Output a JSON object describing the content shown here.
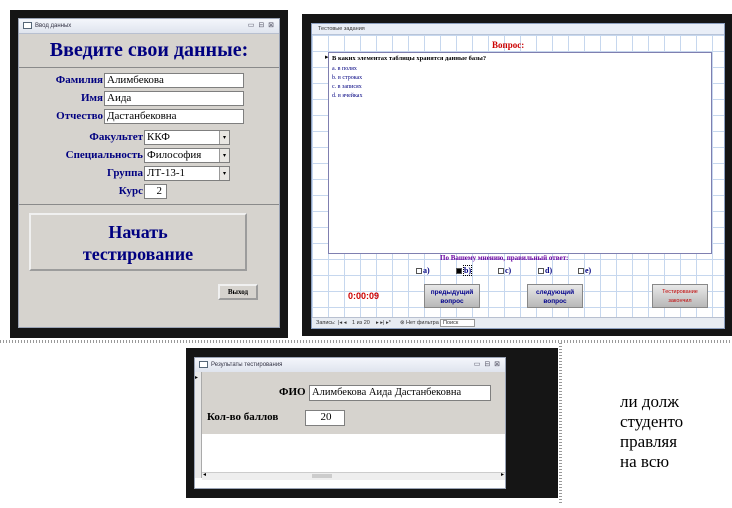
{
  "form1": {
    "window_title": "Ввод данных",
    "window_controls": "▭ ⊟ ⊠",
    "heading": "Введите свои данные:",
    "fields": [
      {
        "label": "Фамилия",
        "value": "Алимбекова"
      },
      {
        "label": "Имя",
        "value": "Аида"
      },
      {
        "label": "Отчество",
        "value": "Дастанбековна"
      }
    ],
    "combos": [
      {
        "label": "Факультет",
        "value": "ККФ"
      },
      {
        "label": "Специальность",
        "value": "Философия"
      },
      {
        "label": "Группа",
        "value": "ЛТ-13-1"
      }
    ],
    "course_label": "Курс",
    "course_value": "2",
    "start_button_line1": "Начать",
    "start_button_line2": "тестирование",
    "exit_button": "Выход"
  },
  "form2": {
    "window_title": "Тестовые задания",
    "question_header": "Вопрос:",
    "question_text": "В каких элементах таблицы хранятся данные базы?",
    "answers": [
      "a. в полях",
      "b. в строках",
      "c. в записях",
      "d. в ячейках"
    ],
    "prompt": "По Вашему мнению, правильный ответ:",
    "options": [
      {
        "label": "a)",
        "checked": false
      },
      {
        "label": "b)",
        "checked": true
      },
      {
        "label": "c)",
        "checked": false
      },
      {
        "label": "d)",
        "checked": false
      },
      {
        "label": "e)",
        "checked": false
      }
    ],
    "timer": "0:00:09",
    "prev_line1": "предыдущий",
    "prev_line2": "вопрос",
    "next_line1": "следующий",
    "next_line2": "вопрос",
    "finish_line1": "Тестирование",
    "finish_line2": "закончил",
    "nav_record": "Запись:",
    "nav_position": "1 из 20",
    "nav_filter": "Нет фильтра",
    "nav_search": "Поиск"
  },
  "form3": {
    "window_title": "Результаты тестирования",
    "window_controls": "▭ ⊟ ⊠",
    "fio_label": "ФИО",
    "fio_value": "Алимбекова Аида Дастанбековна",
    "score_label": "Кол-во баллов",
    "score_value": "20"
  },
  "page_text": [
    "ли долж",
    "студенто",
    "правляя",
    "на всю"
  ],
  "colors": {
    "label_blue": "#000080",
    "timer_red": "#cc0000",
    "question_red": "#cc0000",
    "prompt_purple": "#6a00a0",
    "finish_red": "#c00000",
    "frame": "#151515",
    "form_bg": "#d6d3ce"
  }
}
